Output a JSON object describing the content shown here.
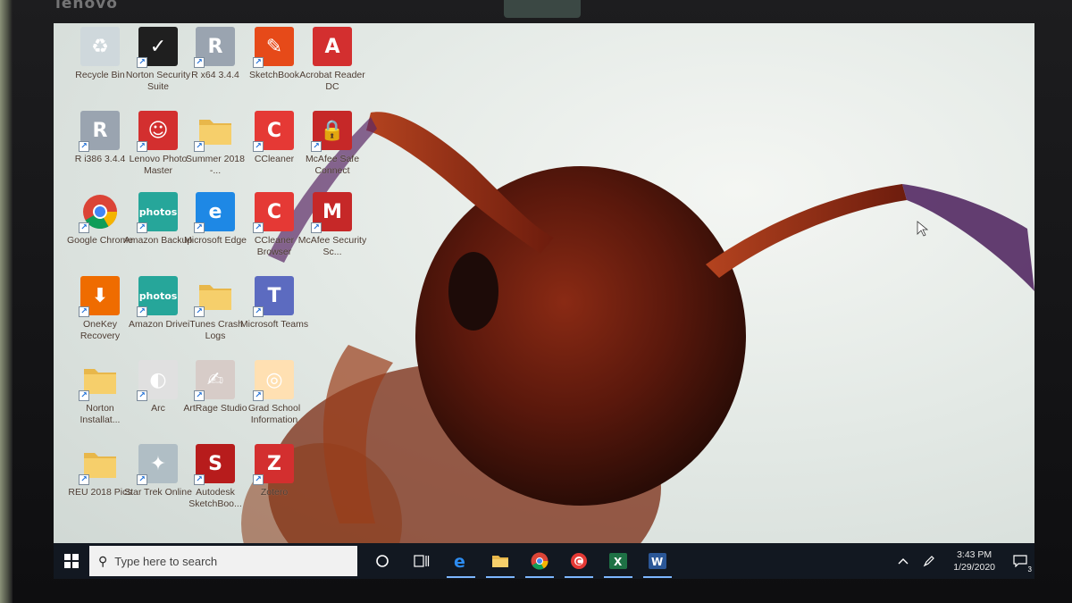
{
  "bezel": {
    "brand": "lenovo"
  },
  "desktop": {
    "icons": [
      {
        "label": "Recycle Bin",
        "icon": "recycle-bin-icon",
        "color": "#cfd8dc",
        "glyph": "♻",
        "shortcut": false
      },
      {
        "label": "Norton Security Suite",
        "icon": "norton-icon",
        "color": "#1f1f1f",
        "glyph": "✓",
        "shortcut": true
      },
      {
        "label": "R x64 3.4.4",
        "icon": "r-icon",
        "color": "#9aa4b0",
        "glyph": "R",
        "shortcut": true
      },
      {
        "label": "SketchBook",
        "icon": "sketchbook-icon",
        "color": "#e64a19",
        "glyph": "✎",
        "shortcut": true
      },
      {
        "label": "Acrobat Reader DC",
        "icon": "acrobat-icon",
        "color": "#d32f2f",
        "glyph": "A",
        "shortcut": false
      },
      {
        "label": "R i386 3.4.4",
        "icon": "r-icon",
        "color": "#9aa4b0",
        "glyph": "R",
        "shortcut": true
      },
      {
        "label": "Lenovo Photo Master",
        "icon": "lenovo-photo-icon",
        "color": "#d32f2f",
        "glyph": "☺",
        "shortcut": true
      },
      {
        "label": "Summer 2018 -...",
        "icon": "folder-icon",
        "color": "#f0c25a",
        "glyph": "",
        "shortcut": true
      },
      {
        "label": "CCleaner",
        "icon": "ccleaner-icon",
        "color": "#e53935",
        "glyph": "C",
        "shortcut": true
      },
      {
        "label": "McAfee Safe Connect",
        "icon": "mcafee-safe-connect-icon",
        "color": "#c62828",
        "glyph": "🔒",
        "shortcut": true
      },
      {
        "label": "Google Chrome",
        "icon": "chrome-icon",
        "color": "#4caf50",
        "glyph": "",
        "shortcut": true
      },
      {
        "label": "Amazon Backup",
        "icon": "amazon-photos-icon",
        "color": "#26a69a",
        "glyph": "photos",
        "shortcut": true
      },
      {
        "label": "Microsoft Edge",
        "icon": "edge-icon",
        "color": "#1e88e5",
        "glyph": "e",
        "shortcut": true
      },
      {
        "label": "CCleaner Browser",
        "icon": "ccleaner-browser-icon",
        "color": "#e53935",
        "glyph": "C",
        "shortcut": true
      },
      {
        "label": "McAfee Security Sc...",
        "icon": "mcafee-icon",
        "color": "#c62828",
        "glyph": "M",
        "shortcut": true
      },
      {
        "label": "OneKey Recovery",
        "icon": "onekey-recovery-icon",
        "color": "#ef6c00",
        "glyph": "⬇",
        "shortcut": true
      },
      {
        "label": "Amazon Drive",
        "icon": "amazon-photos-icon",
        "color": "#26a69a",
        "glyph": "photos",
        "shortcut": true
      },
      {
        "label": "iTunes Crash Logs",
        "icon": "folder-icon",
        "color": "#f0c25a",
        "glyph": "",
        "shortcut": true
      },
      {
        "label": "Microsoft Teams",
        "icon": "teams-icon",
        "color": "#5c6bc0",
        "glyph": "T",
        "shortcut": true
      },
      {
        "label": "",
        "icon": "",
        "color": "",
        "glyph": "",
        "shortcut": false
      },
      {
        "label": "Norton Installat...",
        "icon": "folder-icon",
        "color": "#f0c25a",
        "glyph": "",
        "shortcut": true
      },
      {
        "label": "Arc",
        "icon": "arc-icon",
        "color": "#e0e0e0",
        "glyph": "◐",
        "shortcut": true
      },
      {
        "label": "ArtRage Studio",
        "icon": "artrage-icon",
        "color": "#d7ccc8",
        "glyph": "✍",
        "shortcut": true
      },
      {
        "label": "Grad School Information",
        "icon": "grad-school-icon",
        "color": "#ffe0b2",
        "glyph": "◎",
        "shortcut": true
      },
      {
        "label": "",
        "icon": "",
        "color": "",
        "glyph": "",
        "shortcut": false
      },
      {
        "label": "REU 2018 Pics",
        "icon": "folder-icon",
        "color": "#f0c25a",
        "glyph": "",
        "shortcut": true
      },
      {
        "label": "Star Trek Online",
        "icon": "star-trek-icon",
        "color": "#b0bec5",
        "glyph": "✦",
        "shortcut": true
      },
      {
        "label": "Autodesk SketchBoo...",
        "icon": "sketchbook-sbx-icon",
        "color": "#b71c1c",
        "glyph": "S",
        "shortcut": true
      },
      {
        "label": "Zotero",
        "icon": "zotero-icon",
        "color": "#d32f2f",
        "glyph": "Z",
        "shortcut": true
      }
    ]
  },
  "taskbar": {
    "search_placeholder": "Type here to search",
    "pinned": [
      {
        "name": "cortana",
        "icon": "cortana-icon",
        "running": false
      },
      {
        "name": "task-view",
        "icon": "task-view-icon",
        "running": false
      },
      {
        "name": "edge",
        "icon": "edge-icon",
        "running": true
      },
      {
        "name": "file-explorer",
        "icon": "file-explorer-icon",
        "running": true
      },
      {
        "name": "chrome",
        "icon": "chrome-icon",
        "running": true
      },
      {
        "name": "ccleaner-browser",
        "icon": "ccleaner-browser-icon",
        "running": true
      },
      {
        "name": "excel",
        "icon": "excel-icon",
        "running": true
      },
      {
        "name": "word",
        "icon": "word-icon",
        "running": true
      }
    ],
    "clock": {
      "time": "3:43 PM",
      "date": "1/29/2020"
    },
    "notification_count": "3"
  }
}
